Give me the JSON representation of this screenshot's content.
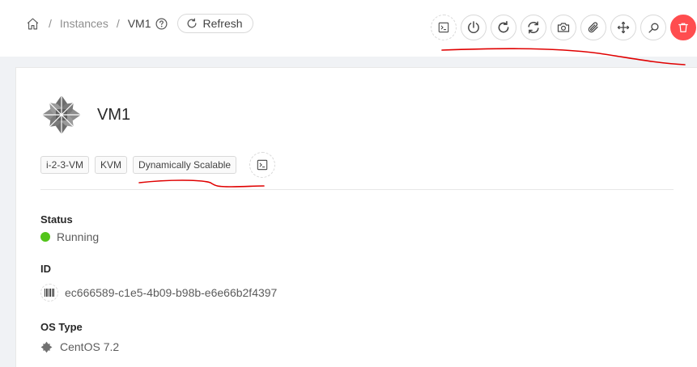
{
  "breadcrumb": {
    "home_icon": "home-icon",
    "separator": "/",
    "section": "Instances",
    "current": "VM1",
    "help_icon": "question-circle-icon"
  },
  "refresh": {
    "label": "Refresh",
    "icon": "reload-icon"
  },
  "actions": [
    {
      "icon": "console-icon"
    },
    {
      "icon": "power-icon"
    },
    {
      "icon": "reboot-icon"
    },
    {
      "icon": "sync-icon"
    },
    {
      "icon": "camera-icon"
    },
    {
      "icon": "paperclip-icon"
    },
    {
      "icon": "drag-icon"
    },
    {
      "icon": "search-icon"
    },
    {
      "icon": "delete-icon"
    }
  ],
  "vm": {
    "name": "VM1",
    "tags": [
      "i-2-3-VM",
      "KVM",
      "Dynamically Scalable"
    ]
  },
  "details": {
    "status_label": "Status",
    "status_value": "Running",
    "id_label": "ID",
    "id_value": "ec666589-c1e5-4b09-b98b-e6e66b2f4397",
    "os_label": "OS Type",
    "os_value": "CentOS 7.2"
  },
  "colors": {
    "running": "#52c41a",
    "danger": "#ff4d4f",
    "annotation": "#e00000"
  }
}
